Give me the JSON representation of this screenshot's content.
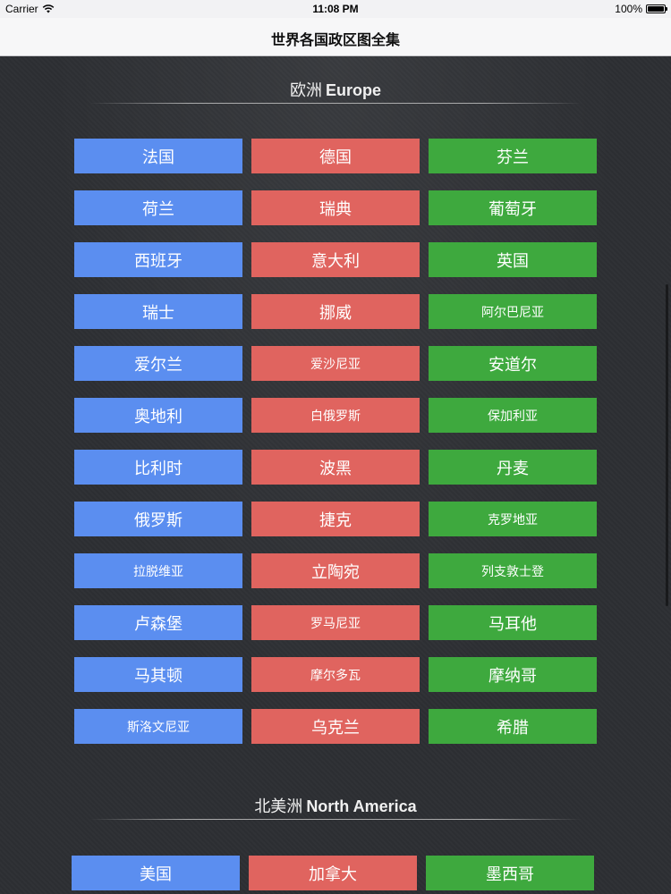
{
  "status_bar": {
    "carrier": "Carrier",
    "time": "11:08 PM",
    "battery": "100%",
    "battery_level": 1.0
  },
  "nav": {
    "title": "世界各国政区图全集"
  },
  "sections": {
    "europe": {
      "title_zh": "欧洲",
      "title_en": "Europe"
    },
    "north_america": {
      "title_zh": "北美洲",
      "title_en": "North America"
    }
  },
  "europe_countries": [
    "法国",
    "德国",
    "芬兰",
    "荷兰",
    "瑞典",
    "葡萄牙",
    "西班牙",
    "意大利",
    "英国",
    "瑞士",
    "挪威",
    "阿尔巴尼亚",
    "爱尔兰",
    "爱沙尼亚",
    "安道尔",
    "奥地利",
    "白俄罗斯",
    "保加利亚",
    "比利时",
    "波黑",
    "丹麦",
    "俄罗斯",
    "捷克",
    "克罗地亚",
    "拉脱维亚",
    "立陶宛",
    "列支敦士登",
    "卢森堡",
    "罗马尼亚",
    "马耳他",
    "马其顿",
    "摩尔多瓦",
    "摩纳哥",
    "斯洛文尼亚",
    "乌克兰",
    "希腊"
  ],
  "north_america_countries": [
    "美国",
    "加拿大",
    "墨西哥"
  ],
  "colors": {
    "column_1": "#5b8ef0",
    "column_2": "#e0645f",
    "column_3": "#3ea93e",
    "background": "#2d2f33"
  }
}
